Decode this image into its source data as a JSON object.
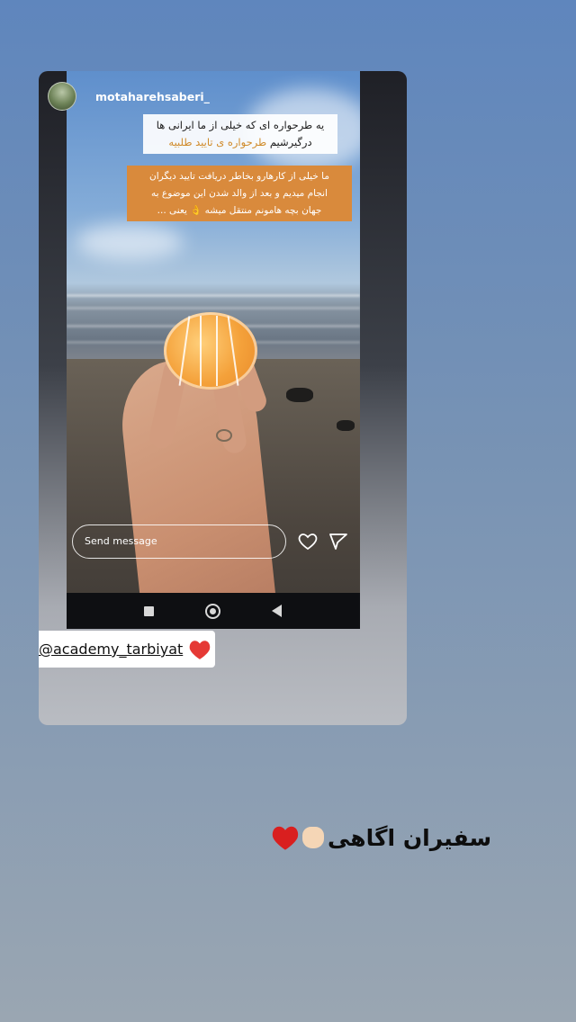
{
  "story": {
    "username": "motaharehsaberi_",
    "caption_1": {
      "line1": "یه طرحواره ای که خیلی از ما ایرانی ها",
      "line2_plain": "درگیرشیم ",
      "line2_highlight": "طرحواره ی تایید طلبیه"
    },
    "caption_2": {
      "line1": "ما خیلی از کارهارو بخاطر دریافت تایید دیگران",
      "line2": "انجام میدیم و بعد از والد شدن این موضوع به",
      "line3": "جهان بچه هامونم منتقل میشه 👌 یعنی ..."
    },
    "send_placeholder": "Send message",
    "icons": {
      "like": "heart-icon",
      "share": "send-icon"
    }
  },
  "mention": {
    "handle": "@academy_tarbiyat",
    "icon": "red-heart-icon"
  },
  "bottom_caption": {
    "text": "سفیران اگاهی",
    "emoji": [
      "ok-hand-icon",
      "red-heart-icon"
    ]
  },
  "colors": {
    "highlight": "#d08b2a",
    "caption_bg": "#d98a3c",
    "heart": "#e53935"
  }
}
